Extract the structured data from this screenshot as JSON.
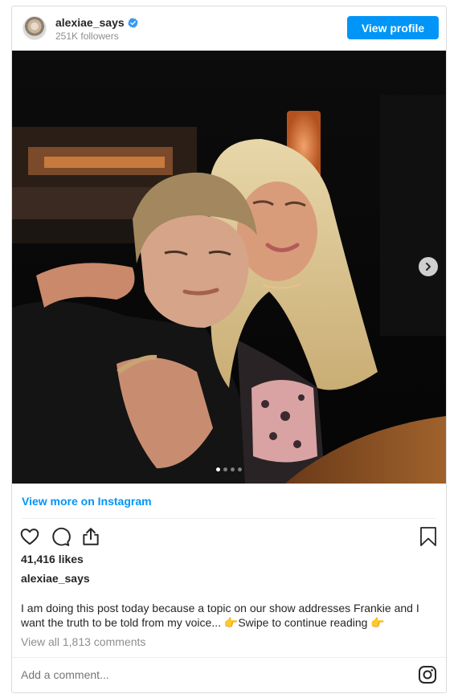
{
  "header": {
    "username": "alexiae_says",
    "followers": "251K followers",
    "view_profile_label": "View profile"
  },
  "post": {
    "view_more_label": "View more on Instagram",
    "likes": "41,416 likes",
    "caption_user": "alexiae_says",
    "caption": "I am doing this post today because a topic on our show addresses Frankie and I want the truth to be told from my voice... 👉Swipe to continue reading 👉",
    "view_comments": "View all 1,813 comments",
    "comment_placeholder": "Add a comment...",
    "carousel": {
      "count": 4,
      "active": 1
    }
  },
  "colors": {
    "accent": "#0095f6",
    "text": "#262626",
    "muted": "#8e8e8e"
  },
  "icons": [
    "verified-badge-icon",
    "chevron-right-icon",
    "heart-icon",
    "comment-icon",
    "share-icon",
    "bookmark-icon",
    "instagram-icon"
  ]
}
